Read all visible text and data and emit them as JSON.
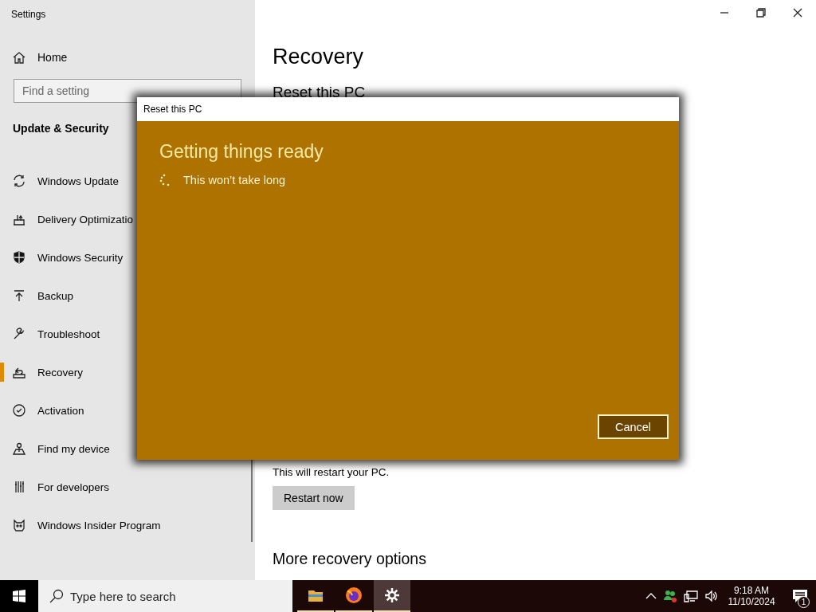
{
  "window": {
    "title": "Settings"
  },
  "sidebar": {
    "home": {
      "label": "Home"
    },
    "search": {
      "placeholder": "Find a setting"
    },
    "section": "Update & Security",
    "items": [
      {
        "label": "Windows Update",
        "selected": false
      },
      {
        "label": "Delivery Optimizatio",
        "selected": false
      },
      {
        "label": "Windows Security",
        "selected": false
      },
      {
        "label": "Backup",
        "selected": false
      },
      {
        "label": "Troubleshoot",
        "selected": false
      },
      {
        "label": "Recovery",
        "selected": true
      },
      {
        "label": "Activation",
        "selected": false
      },
      {
        "label": "Find my device",
        "selected": false
      },
      {
        "label": "For developers",
        "selected": false
      },
      {
        "label": "Windows Insider Program",
        "selected": false
      }
    ]
  },
  "main": {
    "title": "Recovery",
    "reset_heading": "Reset this PC",
    "description_lines": [
      "This will restart your PC."
    ],
    "button": "Restart now",
    "more_heading": "More recovery options"
  },
  "dialog": {
    "title": "Reset this PC",
    "heading": "Getting things ready",
    "status": "This won’t take long",
    "button": "Cancel"
  },
  "taskbar": {
    "search": {
      "placeholder": "Type here to search"
    },
    "apps": [
      {
        "selected": false
      },
      {
        "selected": false
      },
      {
        "selected": true
      }
    ],
    "time": "9:18 AM",
    "date": "11/10/2024",
    "notification_count": "1"
  }
}
